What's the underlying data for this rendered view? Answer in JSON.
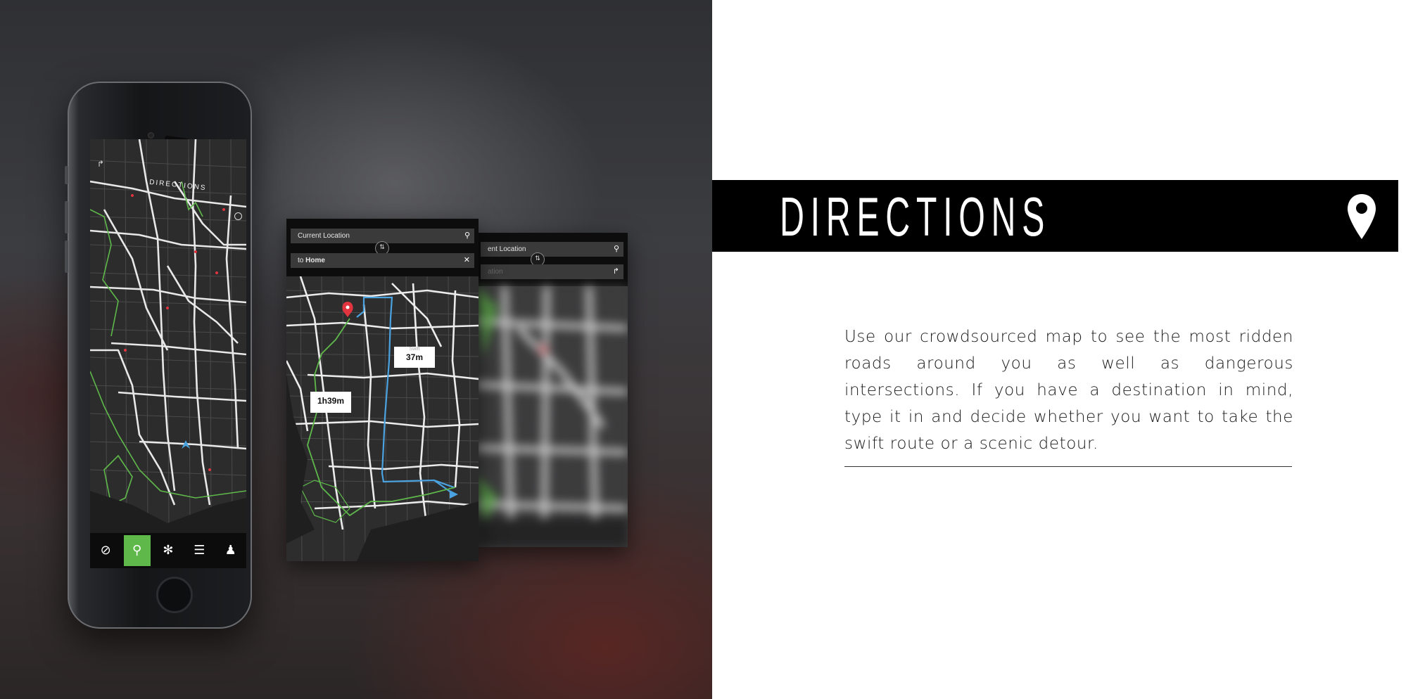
{
  "showcase": {
    "phone": {
      "screen_title": "DIRECTIONS",
      "tabs": [
        {
          "icon": "compass-icon",
          "glyph": "⊘",
          "active": false
        },
        {
          "icon": "map-pin-icon",
          "glyph": "⚲",
          "active": true
        },
        {
          "icon": "wheel-icon",
          "glyph": "✻",
          "active": false
        },
        {
          "icon": "list-icon",
          "glyph": "☰",
          "active": false
        },
        {
          "icon": "profile-icon",
          "glyph": "♟",
          "active": false
        }
      ]
    },
    "route_card": {
      "from_value": "Current Location",
      "to_prefix": "to",
      "to_value": "Home",
      "routes": [
        {
          "name": "Swift",
          "time": "37m"
        },
        {
          "name": "",
          "time": "1h39m"
        }
      ]
    },
    "back_card": {
      "from_value": "ent Location",
      "to_placeholder": "ation"
    }
  },
  "panel": {
    "title": "DIRECTIONS",
    "description": "Use our crowdsourced map to see the most ridden roads around you as well as dangerous intersections. If you have a destination in mind, type it in and decide whether you want to take the swift route or a scenic detour."
  },
  "colors": {
    "accent_green": "#5fb94a",
    "swift_route_blue": "#4aa3e0",
    "scenic_route_green": "#5fb94a",
    "marker_red": "#e0343f",
    "title_bar": "#000000"
  }
}
